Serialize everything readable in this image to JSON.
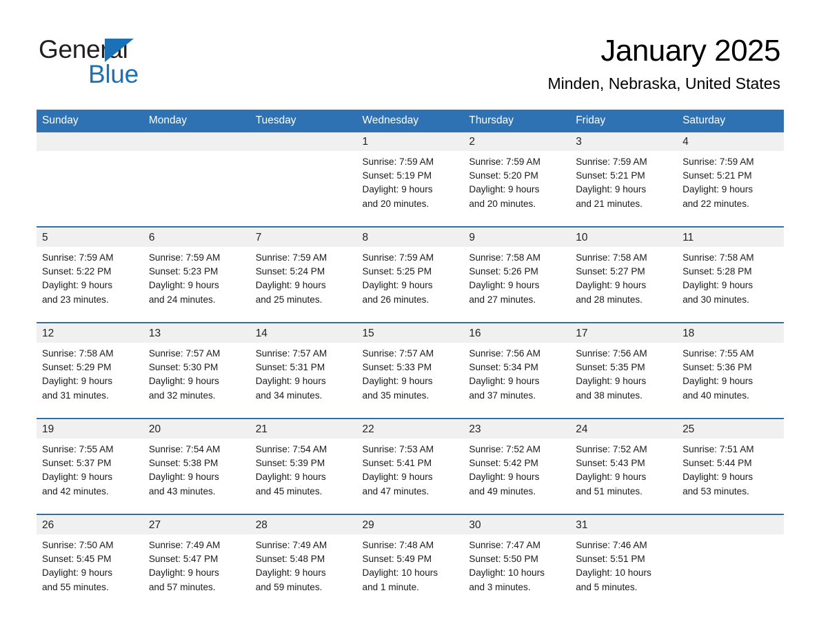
{
  "brand": {
    "name_part1": "General",
    "name_part2": "Blue",
    "triangle_color": "#1a71b8",
    "text_color": "#231f20"
  },
  "header": {
    "month_title": "January 2025",
    "location": "Minden, Nebraska, United States"
  },
  "theme": {
    "header_blue": "#2e72b4",
    "separator_blue": "#2e6da4",
    "daynum_background": "#f0f0f0",
    "page_background": "#ffffff"
  },
  "calendar": {
    "weekday_headers": [
      "Sunday",
      "Monday",
      "Tuesday",
      "Wednesday",
      "Thursday",
      "Friday",
      "Saturday"
    ],
    "weeks": [
      [
        {
          "day": "",
          "sunrise": "",
          "sunset": "",
          "daylight_line1": "",
          "daylight_line2": ""
        },
        {
          "day": "",
          "sunrise": "",
          "sunset": "",
          "daylight_line1": "",
          "daylight_line2": ""
        },
        {
          "day": "",
          "sunrise": "",
          "sunset": "",
          "daylight_line1": "",
          "daylight_line2": ""
        },
        {
          "day": "1",
          "sunrise": "Sunrise: 7:59 AM",
          "sunset": "Sunset: 5:19 PM",
          "daylight_line1": "Daylight: 9 hours",
          "daylight_line2": "and 20 minutes."
        },
        {
          "day": "2",
          "sunrise": "Sunrise: 7:59 AM",
          "sunset": "Sunset: 5:20 PM",
          "daylight_line1": "Daylight: 9 hours",
          "daylight_line2": "and 20 minutes."
        },
        {
          "day": "3",
          "sunrise": "Sunrise: 7:59 AM",
          "sunset": "Sunset: 5:21 PM",
          "daylight_line1": "Daylight: 9 hours",
          "daylight_line2": "and 21 minutes."
        },
        {
          "day": "4",
          "sunrise": "Sunrise: 7:59 AM",
          "sunset": "Sunset: 5:21 PM",
          "daylight_line1": "Daylight: 9 hours",
          "daylight_line2": "and 22 minutes."
        }
      ],
      [
        {
          "day": "5",
          "sunrise": "Sunrise: 7:59 AM",
          "sunset": "Sunset: 5:22 PM",
          "daylight_line1": "Daylight: 9 hours",
          "daylight_line2": "and 23 minutes."
        },
        {
          "day": "6",
          "sunrise": "Sunrise: 7:59 AM",
          "sunset": "Sunset: 5:23 PM",
          "daylight_line1": "Daylight: 9 hours",
          "daylight_line2": "and 24 minutes."
        },
        {
          "day": "7",
          "sunrise": "Sunrise: 7:59 AM",
          "sunset": "Sunset: 5:24 PM",
          "daylight_line1": "Daylight: 9 hours",
          "daylight_line2": "and 25 minutes."
        },
        {
          "day": "8",
          "sunrise": "Sunrise: 7:59 AM",
          "sunset": "Sunset: 5:25 PM",
          "daylight_line1": "Daylight: 9 hours",
          "daylight_line2": "and 26 minutes."
        },
        {
          "day": "9",
          "sunrise": "Sunrise: 7:58 AM",
          "sunset": "Sunset: 5:26 PM",
          "daylight_line1": "Daylight: 9 hours",
          "daylight_line2": "and 27 minutes."
        },
        {
          "day": "10",
          "sunrise": "Sunrise: 7:58 AM",
          "sunset": "Sunset: 5:27 PM",
          "daylight_line1": "Daylight: 9 hours",
          "daylight_line2": "and 28 minutes."
        },
        {
          "day": "11",
          "sunrise": "Sunrise: 7:58 AM",
          "sunset": "Sunset: 5:28 PM",
          "daylight_line1": "Daylight: 9 hours",
          "daylight_line2": "and 30 minutes."
        }
      ],
      [
        {
          "day": "12",
          "sunrise": "Sunrise: 7:58 AM",
          "sunset": "Sunset: 5:29 PM",
          "daylight_line1": "Daylight: 9 hours",
          "daylight_line2": "and 31 minutes."
        },
        {
          "day": "13",
          "sunrise": "Sunrise: 7:57 AM",
          "sunset": "Sunset: 5:30 PM",
          "daylight_line1": "Daylight: 9 hours",
          "daylight_line2": "and 32 minutes."
        },
        {
          "day": "14",
          "sunrise": "Sunrise: 7:57 AM",
          "sunset": "Sunset: 5:31 PM",
          "daylight_line1": "Daylight: 9 hours",
          "daylight_line2": "and 34 minutes."
        },
        {
          "day": "15",
          "sunrise": "Sunrise: 7:57 AM",
          "sunset": "Sunset: 5:33 PM",
          "daylight_line1": "Daylight: 9 hours",
          "daylight_line2": "and 35 minutes."
        },
        {
          "day": "16",
          "sunrise": "Sunrise: 7:56 AM",
          "sunset": "Sunset: 5:34 PM",
          "daylight_line1": "Daylight: 9 hours",
          "daylight_line2": "and 37 minutes."
        },
        {
          "day": "17",
          "sunrise": "Sunrise: 7:56 AM",
          "sunset": "Sunset: 5:35 PM",
          "daylight_line1": "Daylight: 9 hours",
          "daylight_line2": "and 38 minutes."
        },
        {
          "day": "18",
          "sunrise": "Sunrise: 7:55 AM",
          "sunset": "Sunset: 5:36 PM",
          "daylight_line1": "Daylight: 9 hours",
          "daylight_line2": "and 40 minutes."
        }
      ],
      [
        {
          "day": "19",
          "sunrise": "Sunrise: 7:55 AM",
          "sunset": "Sunset: 5:37 PM",
          "daylight_line1": "Daylight: 9 hours",
          "daylight_line2": "and 42 minutes."
        },
        {
          "day": "20",
          "sunrise": "Sunrise: 7:54 AM",
          "sunset": "Sunset: 5:38 PM",
          "daylight_line1": "Daylight: 9 hours",
          "daylight_line2": "and 43 minutes."
        },
        {
          "day": "21",
          "sunrise": "Sunrise: 7:54 AM",
          "sunset": "Sunset: 5:39 PM",
          "daylight_line1": "Daylight: 9 hours",
          "daylight_line2": "and 45 minutes."
        },
        {
          "day": "22",
          "sunrise": "Sunrise: 7:53 AM",
          "sunset": "Sunset: 5:41 PM",
          "daylight_line1": "Daylight: 9 hours",
          "daylight_line2": "and 47 minutes."
        },
        {
          "day": "23",
          "sunrise": "Sunrise: 7:52 AM",
          "sunset": "Sunset: 5:42 PM",
          "daylight_line1": "Daylight: 9 hours",
          "daylight_line2": "and 49 minutes."
        },
        {
          "day": "24",
          "sunrise": "Sunrise: 7:52 AM",
          "sunset": "Sunset: 5:43 PM",
          "daylight_line1": "Daylight: 9 hours",
          "daylight_line2": "and 51 minutes."
        },
        {
          "day": "25",
          "sunrise": "Sunrise: 7:51 AM",
          "sunset": "Sunset: 5:44 PM",
          "daylight_line1": "Daylight: 9 hours",
          "daylight_line2": "and 53 minutes."
        }
      ],
      [
        {
          "day": "26",
          "sunrise": "Sunrise: 7:50 AM",
          "sunset": "Sunset: 5:45 PM",
          "daylight_line1": "Daylight: 9 hours",
          "daylight_line2": "and 55 minutes."
        },
        {
          "day": "27",
          "sunrise": "Sunrise: 7:49 AM",
          "sunset": "Sunset: 5:47 PM",
          "daylight_line1": "Daylight: 9 hours",
          "daylight_line2": "and 57 minutes."
        },
        {
          "day": "28",
          "sunrise": "Sunrise: 7:49 AM",
          "sunset": "Sunset: 5:48 PM",
          "daylight_line1": "Daylight: 9 hours",
          "daylight_line2": "and 59 minutes."
        },
        {
          "day": "29",
          "sunrise": "Sunrise: 7:48 AM",
          "sunset": "Sunset: 5:49 PM",
          "daylight_line1": "Daylight: 10 hours",
          "daylight_line2": "and 1 minute."
        },
        {
          "day": "30",
          "sunrise": "Sunrise: 7:47 AM",
          "sunset": "Sunset: 5:50 PM",
          "daylight_line1": "Daylight: 10 hours",
          "daylight_line2": "and 3 minutes."
        },
        {
          "day": "31",
          "sunrise": "Sunrise: 7:46 AM",
          "sunset": "Sunset: 5:51 PM",
          "daylight_line1": "Daylight: 10 hours",
          "daylight_line2": "and 5 minutes."
        },
        {
          "day": "",
          "sunrise": "",
          "sunset": "",
          "daylight_line1": "",
          "daylight_line2": ""
        }
      ]
    ]
  }
}
